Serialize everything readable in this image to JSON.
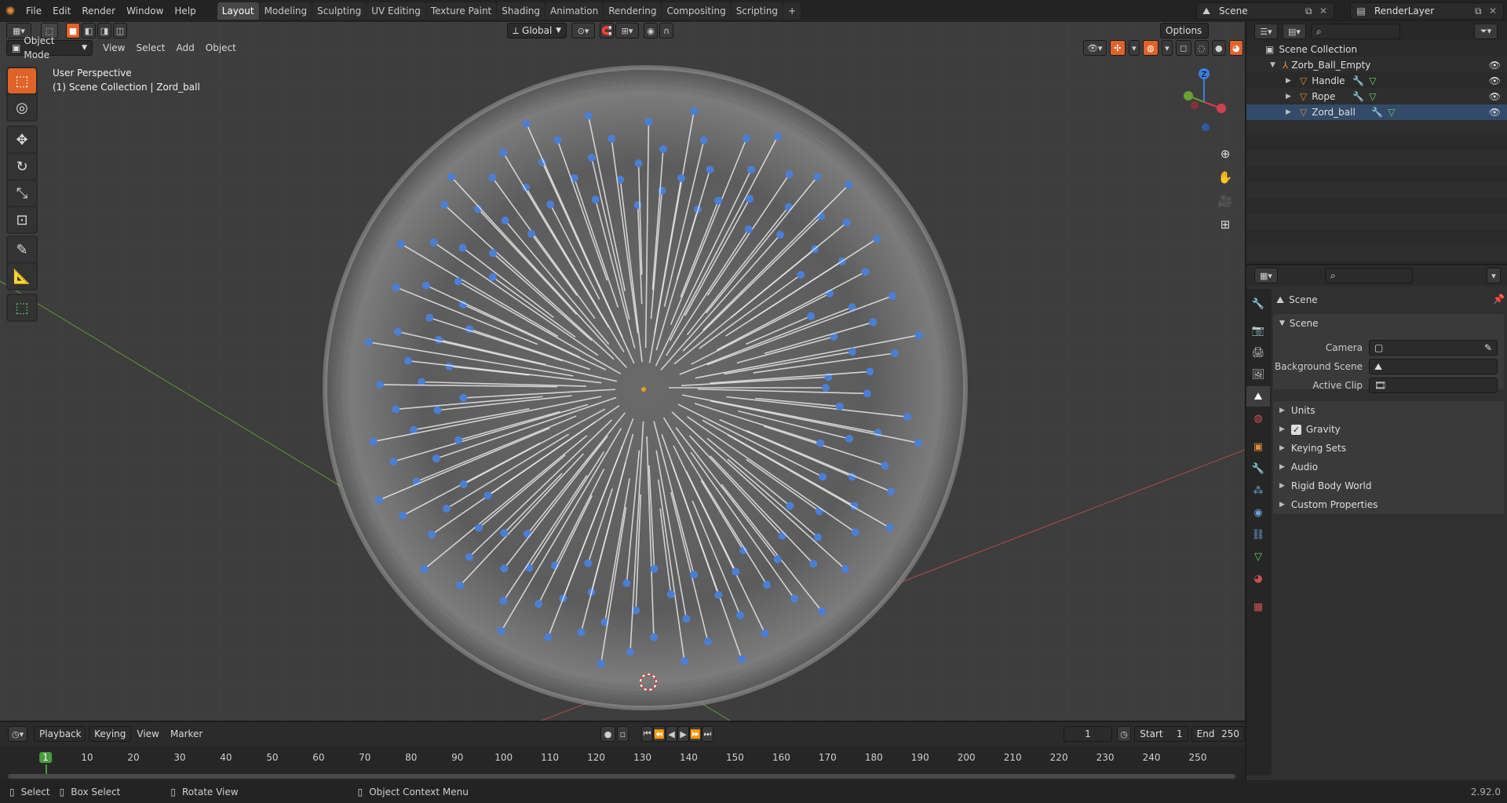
{
  "topbar": {
    "menus": [
      "File",
      "Edit",
      "Render",
      "Window",
      "Help"
    ],
    "workspaces": [
      "Layout",
      "Modeling",
      "Sculpting",
      "UV Editing",
      "Texture Paint",
      "Shading",
      "Animation",
      "Rendering",
      "Compositing",
      "Scripting"
    ],
    "active_workspace": "Layout",
    "add_tab": "+",
    "scene_name": "Scene",
    "view_layer": "RenderLayer"
  },
  "viewport_header": {
    "mode": "Object Mode",
    "menus": [
      "View",
      "Select",
      "Add",
      "Object"
    ],
    "transform_orientation": "Global",
    "options": "Options"
  },
  "viewport_overlay": {
    "perspective": "User Perspective",
    "collection": "(1) Scene Collection | Zord_ball"
  },
  "gizmo": {
    "z_label": "Z"
  },
  "outliner": {
    "root": "Scene Collection",
    "items": [
      {
        "name": "Zorb_Ball_Empty",
        "depth": 1
      },
      {
        "name": "Handle",
        "depth": 2
      },
      {
        "name": "Rope",
        "depth": 2
      },
      {
        "name": "Zord_ball",
        "depth": 2
      }
    ]
  },
  "properties": {
    "context": "Scene",
    "panel_title": "Scene",
    "fields": [
      {
        "label": "Camera"
      },
      {
        "label": "Background Scene"
      },
      {
        "label": "Active Clip"
      }
    ],
    "sections": [
      "Units",
      "Gravity",
      "Keying Sets",
      "Audio",
      "Rigid Body World",
      "Custom Properties"
    ],
    "gravity_checked": true
  },
  "timeline": {
    "menus": [
      "Playback",
      "Keying",
      "View",
      "Marker"
    ],
    "current_frame": "1",
    "start_label": "Start",
    "start_value": "1",
    "end_label": "End",
    "end_value": "250",
    "ticks": [
      "1",
      "10",
      "20",
      "30",
      "40",
      "50",
      "60",
      "70",
      "80",
      "90",
      "100",
      "110",
      "120",
      "130",
      "140",
      "150",
      "160",
      "170",
      "180",
      "190",
      "200",
      "210",
      "220",
      "230",
      "240",
      "250"
    ]
  },
  "statusbar": {
    "select": "Select",
    "box_select": "Box Select",
    "rotate_view": "Rotate View",
    "context_menu": "Object Context Menu",
    "version": "2.92.0"
  },
  "colors": {
    "accent": "#e0632a",
    "viewport_bg": "#3d3d3d",
    "axis_x": "#a2464a",
    "axis_y": "#5a8a3a",
    "ball_blue": "#4a7fd6"
  }
}
